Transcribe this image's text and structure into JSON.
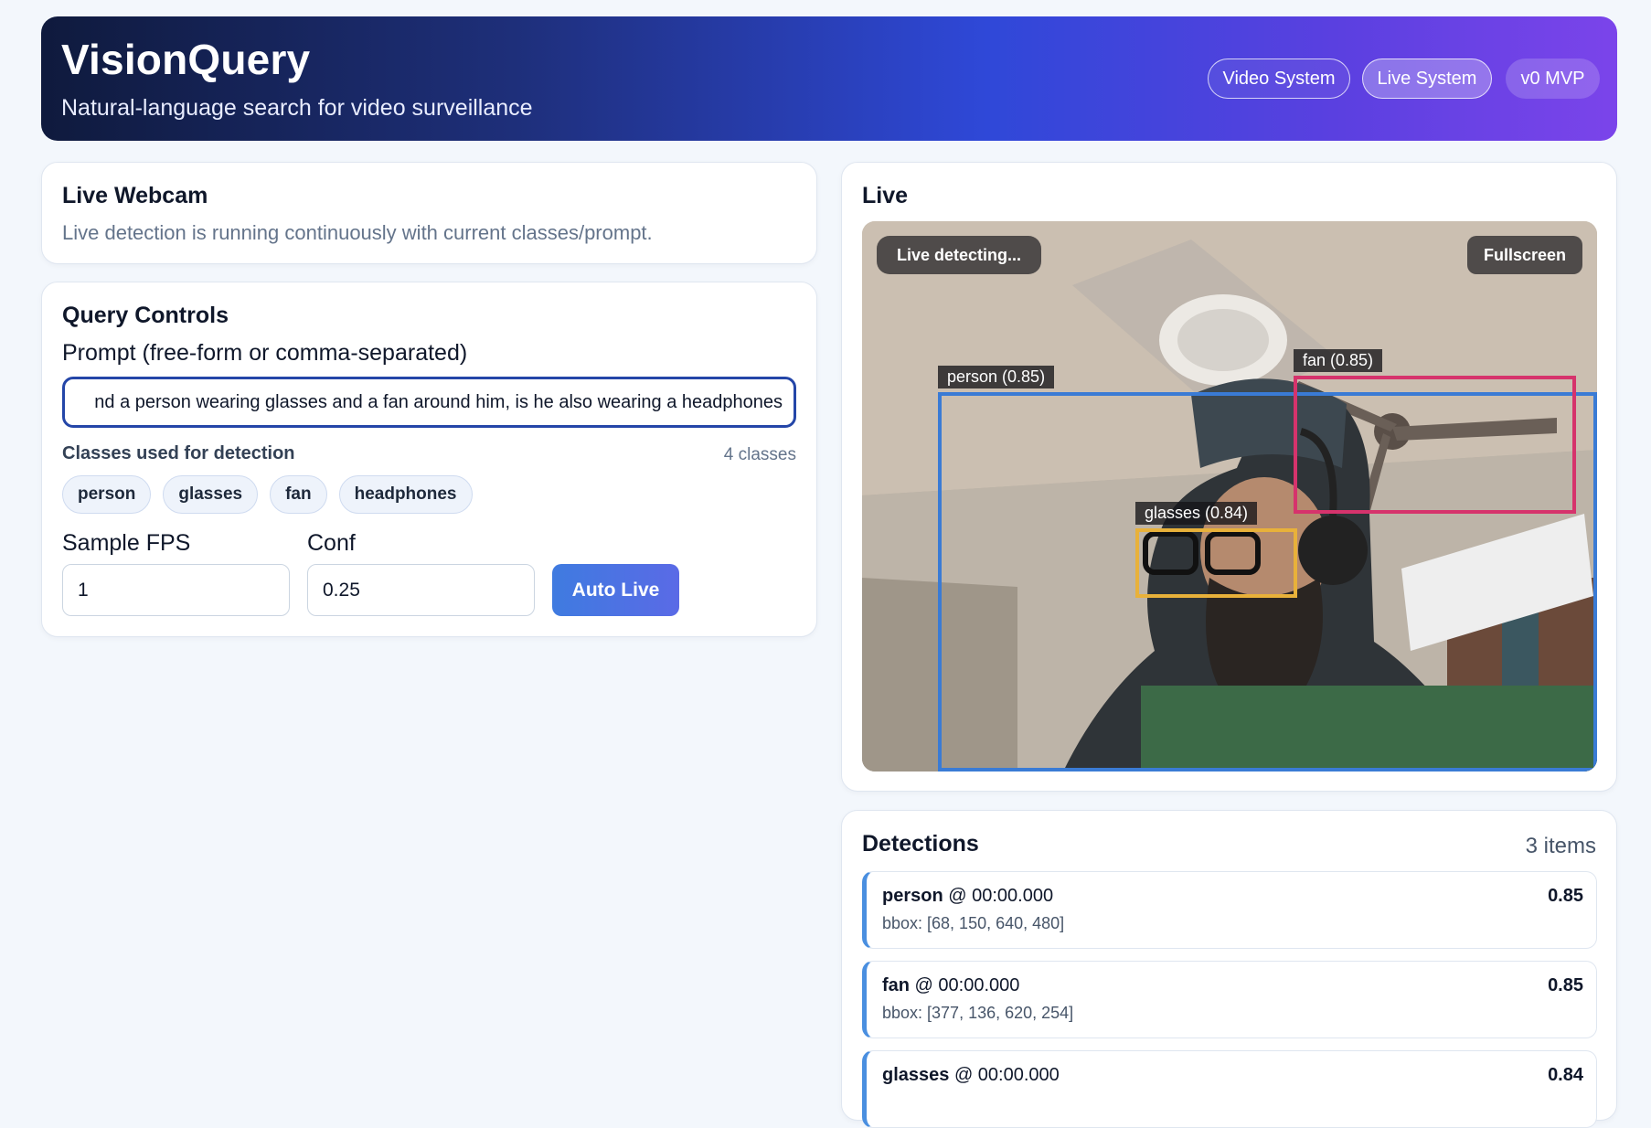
{
  "header": {
    "title": "VisionQuery",
    "subtitle": "Natural-language search for video surveillance",
    "nav": [
      "Video System",
      "Live System"
    ],
    "version_badge": "v0 MVP"
  },
  "webcam": {
    "title": "Live Webcam",
    "description": "Live detection is running continuously with current classes/prompt."
  },
  "controls": {
    "title": "Query Controls",
    "prompt_label": "Prompt (free-form or comma-separated)",
    "prompt_value": "nd a person wearing glasses and a fan around him, is he also wearing a headphones",
    "classes_label": "Classes used for detection",
    "classes_count": "4 classes",
    "classes": [
      "person",
      "glasses",
      "fan",
      "headphones"
    ],
    "fps_label": "Sample FPS",
    "fps_value": "1",
    "conf_label": "Conf",
    "conf_value": "0.25",
    "auto_live_label": "Auto Live"
  },
  "live": {
    "title": "Live",
    "status": "Live detecting...",
    "fullscreen_label": "Fullscreen",
    "boxes": [
      {
        "label": "person (0.85)",
        "color": "#3a7bd5"
      },
      {
        "label": "fan (0.85)",
        "color": "#d6336c"
      },
      {
        "label": "glasses (0.84)",
        "color": "#e8b13a"
      }
    ]
  },
  "detections": {
    "title": "Detections",
    "count": "3 items",
    "items": [
      {
        "cls": "person",
        "time": " @ 00:00.000",
        "bbox": "bbox: [68, 150, 640, 480]",
        "score": "0.85"
      },
      {
        "cls": "fan",
        "time": " @ 00:00.000",
        "bbox": "bbox: [377, 136, 620, 254]",
        "score": "0.85"
      },
      {
        "cls": "glasses",
        "time": " @ 00:00.000",
        "bbox": "",
        "score": "0.84"
      }
    ]
  }
}
